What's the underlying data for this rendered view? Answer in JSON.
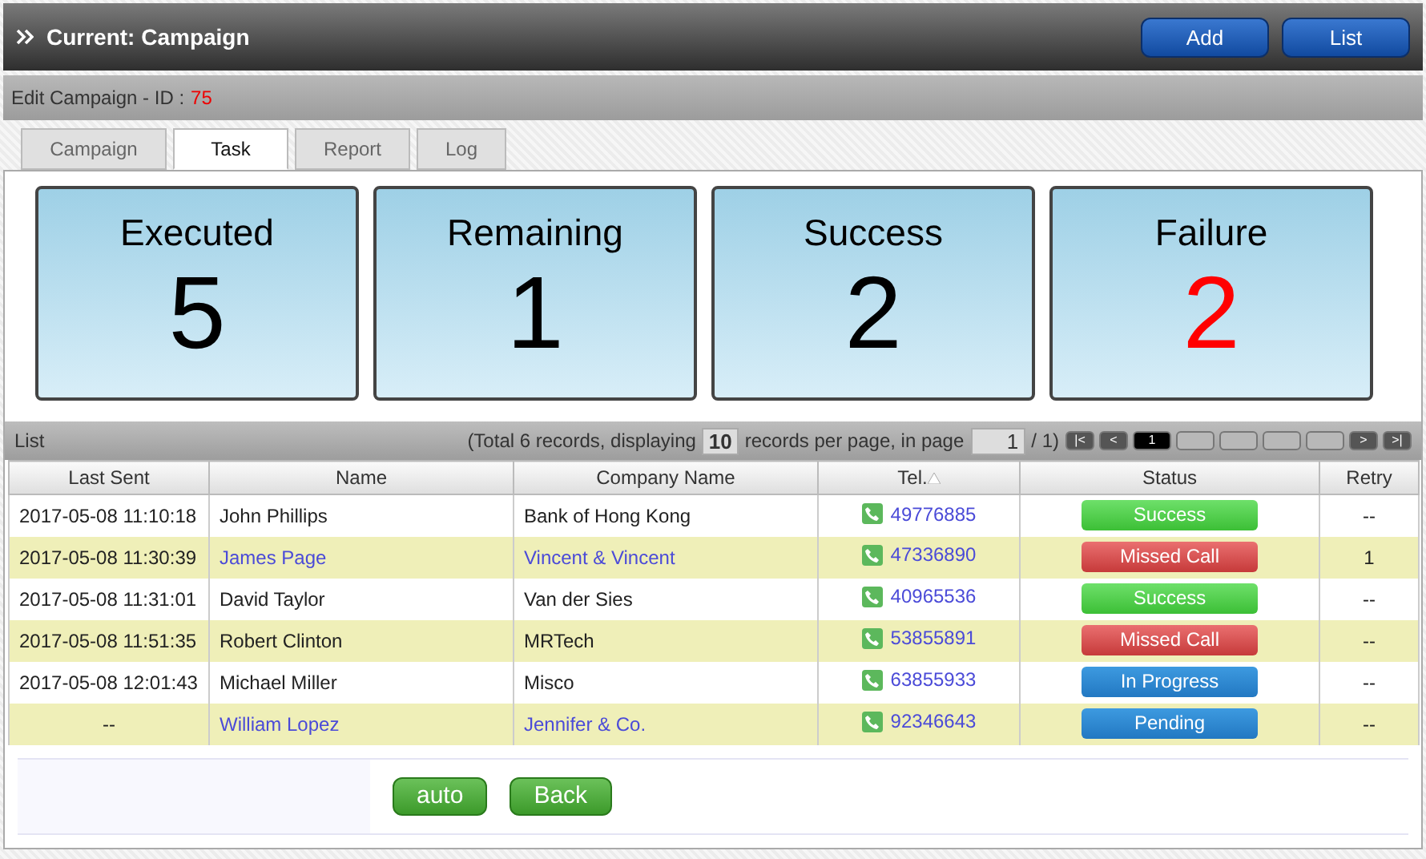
{
  "header": {
    "title": "Current: Campaign",
    "buttons": [
      "Add",
      "List"
    ]
  },
  "edit_bar": {
    "label": "Edit Campaign - ID :",
    "id": "75"
  },
  "tabs": [
    {
      "label": "Campaign",
      "selected": false
    },
    {
      "label": "Task",
      "selected": true
    },
    {
      "label": "Report",
      "selected": false
    },
    {
      "label": "Log",
      "selected": false
    }
  ],
  "stats": [
    {
      "label": "Executed",
      "value": "5",
      "color": "#000000"
    },
    {
      "label": "Remaining",
      "value": "1",
      "color": "#000000"
    },
    {
      "label": "Success",
      "value": "2",
      "color": "#000000"
    },
    {
      "label": "Failure",
      "value": "2",
      "color": "#ff0000"
    }
  ],
  "list": {
    "title": "List",
    "summary_start": "(Total 6 records, displaying",
    "per_page": "10",
    "summary_mid": "records per page, in page",
    "page": "1",
    "summary_end": "/ 1)",
    "pager": [
      {
        "label": "|<",
        "kind": "nav"
      },
      {
        "label": "<",
        "kind": "nav"
      },
      {
        "label": "1",
        "kind": "page",
        "selected": true
      },
      {
        "kind": "page",
        "selected": false
      },
      {
        "kind": "page",
        "selected": false
      },
      {
        "kind": "page",
        "selected": false
      },
      {
        "kind": "page",
        "selected": false
      },
      {
        "label": ">",
        "kind": "nav"
      },
      {
        "label": ">|",
        "kind": "nav"
      }
    ]
  },
  "table": {
    "columns": [
      {
        "label": "Last Sent",
        "sorted": false
      },
      {
        "label": "Name",
        "sorted": false
      },
      {
        "label": "Company Name",
        "sorted": false
      },
      {
        "label": "Tel.",
        "sorted": true
      },
      {
        "label": "Status",
        "sorted": false
      },
      {
        "label": "Retry",
        "sorted": false
      }
    ],
    "rows": [
      {
        "last_sent": "2017-05-08 11:10:18",
        "name": "John Phillips",
        "company": "Bank of Hong Kong",
        "tel": "49776885",
        "status": "Success",
        "kind": "success",
        "retry": "--",
        "highlighted": false,
        "linked": false
      },
      {
        "last_sent": "2017-05-08 11:30:39",
        "name": "James Page",
        "company": "Vincent & Vincent",
        "tel": "47336890",
        "status": "Missed Call",
        "kind": "missed",
        "retry": "1",
        "highlighted": true,
        "linked": true
      },
      {
        "last_sent": "2017-05-08 11:31:01",
        "name": "David Taylor",
        "company": "Van der Sies",
        "tel": "40965536",
        "status": "Success",
        "kind": "success",
        "retry": "--",
        "highlighted": false,
        "linked": false
      },
      {
        "last_sent": "2017-05-08 11:51:35",
        "name": "Robert Clinton",
        "company": "MRTech",
        "tel": "53855891",
        "status": "Missed Call",
        "kind": "missed",
        "retry": "--",
        "highlighted": true,
        "linked": false
      },
      {
        "last_sent": "2017-05-08 12:01:43",
        "name": "Michael Miller",
        "company": "Misco",
        "tel": "63855933",
        "status": "In Progress",
        "kind": "progress",
        "retry": "--",
        "highlighted": false,
        "linked": false
      },
      {
        "last_sent": "--",
        "name": "William Lopez",
        "company": "Jennifer & Co.",
        "tel": "92346643",
        "status": "Pending",
        "kind": "pending",
        "retry": "--",
        "highlighted": true,
        "linked": true
      }
    ]
  },
  "footer": {
    "buttons": [
      "auto",
      "Back"
    ]
  }
}
